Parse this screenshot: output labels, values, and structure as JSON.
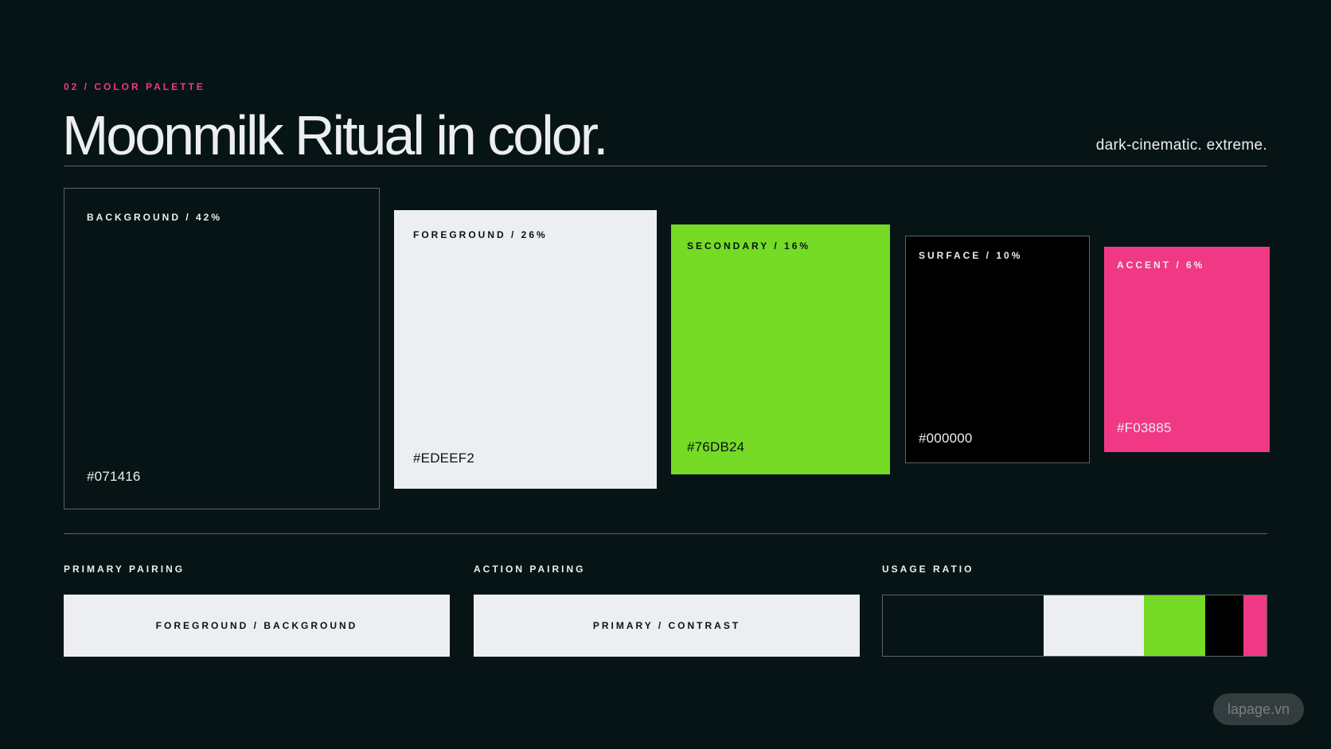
{
  "header": {
    "eyebrow": "02 / COLOR PALETTE",
    "title": "Moonmilk Ritual in color.",
    "tagline": "dark-cinematic. extreme."
  },
  "swatches": [
    {
      "label": "BACKGROUND / 42%",
      "hex": "#071416",
      "color": "#071416",
      "text_color": "#EDEEF2",
      "share_percent": 42
    },
    {
      "label": "FOREGROUND / 26%",
      "hex": "#EDEEF2",
      "color": "#EDEEF2",
      "text_color": "#071416",
      "share_percent": 26
    },
    {
      "label": "SECONDARY / 16%",
      "hex": "#76DB24",
      "color": "#76DB24",
      "text_color": "#071416",
      "share_percent": 16
    },
    {
      "label": "SURFACE / 10%",
      "hex": "#000000",
      "color": "#000000",
      "text_color": "#EDEEF2",
      "share_percent": 10
    },
    {
      "label": "ACCENT / 6%",
      "hex": "#F03885",
      "color": "#F03885",
      "text_color": "#EDEEF2",
      "share_percent": 6
    }
  ],
  "pairings": {
    "primary": {
      "label": "PRIMARY PAIRING",
      "box_text": "FOREGROUND / BACKGROUND"
    },
    "action": {
      "label": "ACTION PAIRING",
      "box_text": "PRIMARY / CONTRAST"
    }
  },
  "usage": {
    "label": "USAGE RATIO",
    "segments": [
      {
        "color": "#071416",
        "percent": 42
      },
      {
        "color": "#EDEEF2",
        "percent": 26
      },
      {
        "color": "#76DB24",
        "percent": 16
      },
      {
        "color": "#000000",
        "percent": 10
      },
      {
        "color": "#F03885",
        "percent": 6
      }
    ]
  },
  "watermark": "lapage.vn"
}
